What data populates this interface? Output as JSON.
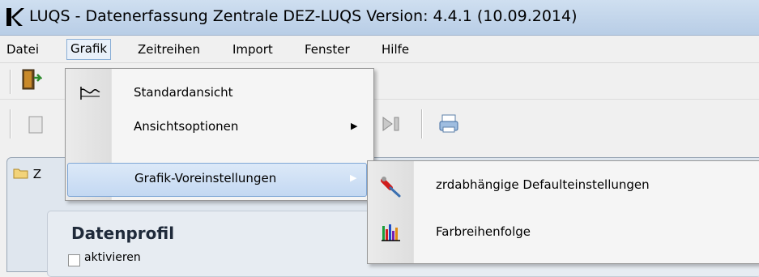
{
  "window": {
    "title": "LUQS - Datenerfassung Zentrale DEZ-LUQS Version: 4.4.1 (10.09.2014)",
    "logo_icon": "luqs-logo-icon"
  },
  "menubar": {
    "items": [
      {
        "label": "Datei"
      },
      {
        "label": "Grafik"
      },
      {
        "label": "Zeitreihen"
      },
      {
        "label": "Import"
      },
      {
        "label": "Fenster"
      },
      {
        "label": "Hilfe"
      }
    ],
    "open_item": "Grafik"
  },
  "toolbar": {
    "icons": [
      "exit-door-icon",
      "document-icon",
      "play-end-icon",
      "print-icon"
    ]
  },
  "grafik_menu": {
    "items": [
      {
        "label": "Standardansicht",
        "icon": "standard-view-icon",
        "has_submenu": false
      },
      {
        "label": "Ansichtsoptionen",
        "icon": "",
        "has_submenu": true
      },
      {
        "label": "Grafik-Voreinstellungen",
        "icon": "",
        "has_submenu": true,
        "highlighted": true
      }
    ]
  },
  "submenu": {
    "items": [
      {
        "label": "zrdabhängige Defaulteinstellungen",
        "icon": "tools-icon"
      },
      {
        "label": "Farbreihenfolge",
        "icon": "color-bars-icon"
      }
    ]
  },
  "panel": {
    "tab_label": "Z",
    "group_title": "Datenprofil",
    "checkbox_label": "aktivieren",
    "checkbox_checked": false
  },
  "colors": {
    "highlight": "#c3d8f2",
    "highlight_border": "#7fa7d6",
    "titlebar": "#c4d6ec"
  }
}
